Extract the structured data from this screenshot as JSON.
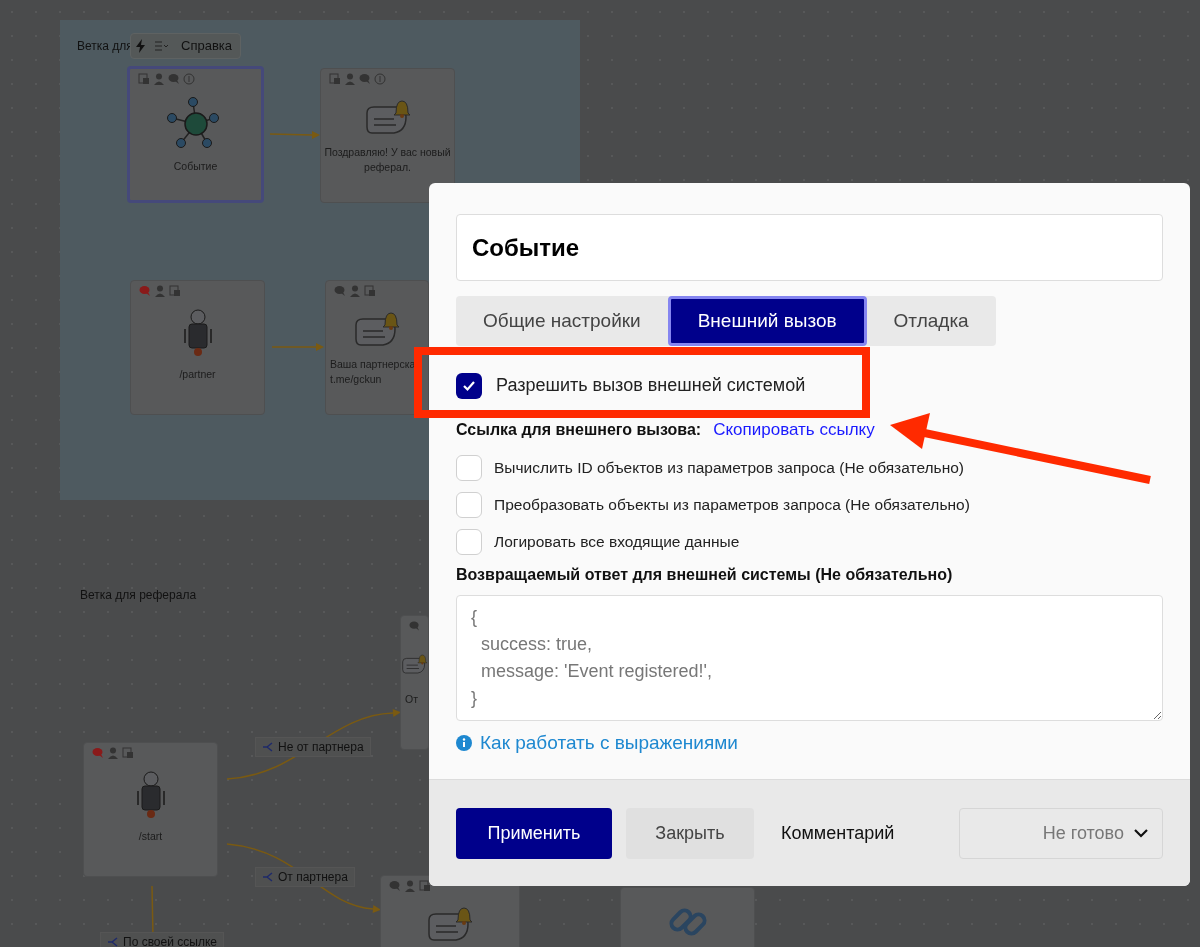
{
  "canvas": {
    "groups": [
      {
        "title": "Ветка для"
      },
      {
        "title": "Ветка для реферала"
      }
    ],
    "toolbar": {
      "help_label": "Справка"
    },
    "nodes": [
      {
        "kind": "event",
        "lines": [
          "Событие"
        ],
        "selected": true
      },
      {
        "kind": "message",
        "lines": [
          "Поздравляю! У вас новый",
          "реферал."
        ],
        "selected": false
      },
      {
        "kind": "bot",
        "lines": [
          "/partner"
        ],
        "selected": false
      },
      {
        "kind": "message",
        "lines": [
          "Ваша партнерска",
          "t.me/gckun"
        ],
        "selected": false
      },
      {
        "kind": "bot",
        "lines": [
          "/start"
        ],
        "selected": false
      },
      {
        "kind": "message",
        "lines": [
          "От"
        ],
        "selected": false
      },
      {
        "kind": "message",
        "selected": false
      },
      {
        "kind": "link",
        "selected": false
      }
    ],
    "edge_labels": [
      "Не от партнера",
      "От партнера",
      "По своей ссылке"
    ]
  },
  "dialog": {
    "title_value": "Событие",
    "tabs": [
      {
        "label": "Общие настройки",
        "selected": false
      },
      {
        "label": "Внешний вызов",
        "selected": true
      },
      {
        "label": "Отладка",
        "selected": false
      }
    ],
    "allow_checkbox": {
      "label": "Разрешить вызов внешней системой",
      "checked": true
    },
    "link_row": {
      "label": "Ссылка для внешнего вызова:",
      "link": "Скопировать ссылку"
    },
    "options": [
      {
        "label": "Вычислить ID объектов из параметров запроса (Не обязательно)",
        "checked": false
      },
      {
        "label": "Преобразовать объекты из параметров запроса (Не обязательно)",
        "checked": false
      },
      {
        "label": "Логировать все входящие данные",
        "checked": false
      }
    ],
    "response": {
      "label": "Возвращаемый ответ для внешней системы (Не обязательно)",
      "value": "{\n  success: true,\n  message: 'Event registered!',\n}"
    },
    "help_link": "Как работать с выражениями",
    "footer": {
      "apply": "Применить",
      "close": "Закрыть",
      "comment": "Комментарий",
      "status": "Не готово"
    }
  }
}
